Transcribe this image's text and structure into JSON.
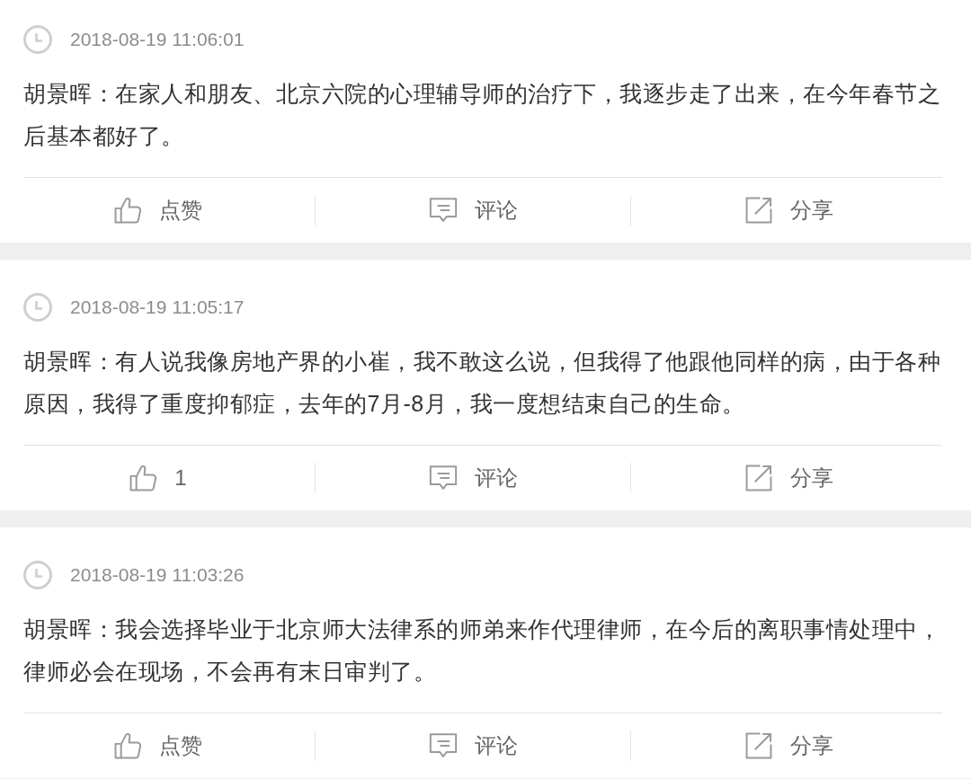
{
  "posts": [
    {
      "timestamp": "2018-08-19 11:06:01",
      "text": "胡景晖：在家人和朋友、北京六院的心理辅导师的治疗下，我逐步走了出来，在今年春节之后基本都好了。",
      "actions": [
        {
          "kind": "like",
          "label": "点赞"
        },
        {
          "kind": "comment",
          "label": "评论"
        },
        {
          "kind": "share",
          "label": "分享"
        }
      ]
    },
    {
      "timestamp": "2018-08-19 11:05:17",
      "text": "胡景晖：有人说我像房地产界的小崔，我不敢这么说，但我得了他跟他同样的病，由于各种原因，我得了重度抑郁症，去年的7月-8月，我一度想结束自己的生命。",
      "actions": [
        {
          "kind": "like",
          "label": "1"
        },
        {
          "kind": "comment",
          "label": "评论"
        },
        {
          "kind": "share",
          "label": "分享"
        }
      ]
    },
    {
      "timestamp": "2018-08-19 11:03:26",
      "text": "胡景晖：我会选择毕业于北京师大法律系的师弟来作代理律师，在今后的离职事情处理中，律师必会在现场，不会再有末日审判了。",
      "actions": [
        {
          "kind": "like",
          "label": "点赞"
        },
        {
          "kind": "comment",
          "label": "评论"
        },
        {
          "kind": "share",
          "label": "分享"
        }
      ]
    }
  ]
}
